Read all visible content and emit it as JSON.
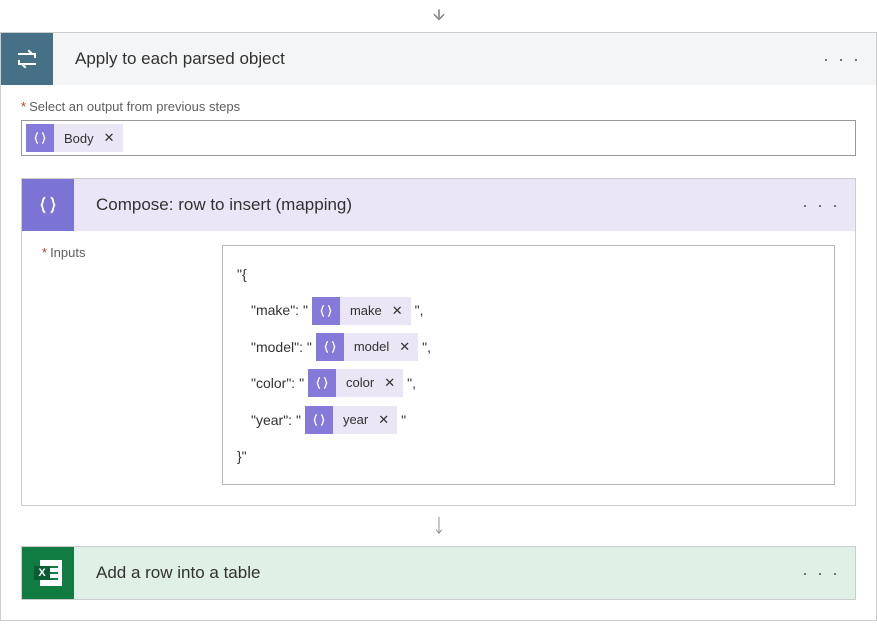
{
  "outerAction": {
    "title": "Apply to each parsed object",
    "selectLabel": "Select an output from previous steps",
    "outputToken": "Body"
  },
  "compose": {
    "title": "Compose: row to insert (mapping)",
    "inputsLabel": "Inputs",
    "open": "\"{",
    "close": "}\"",
    "rows": [
      {
        "key": "\"make\": \"",
        "token": "make",
        "after": "\","
      },
      {
        "key": "\"model\": \"",
        "token": "model",
        "after": "\","
      },
      {
        "key": "\"color\": \"",
        "token": "color",
        "after": "\","
      },
      {
        "key": "\"year\": \"",
        "token": "year",
        "after": "\""
      }
    ]
  },
  "excelAction": {
    "title": "Add a row into a table"
  }
}
